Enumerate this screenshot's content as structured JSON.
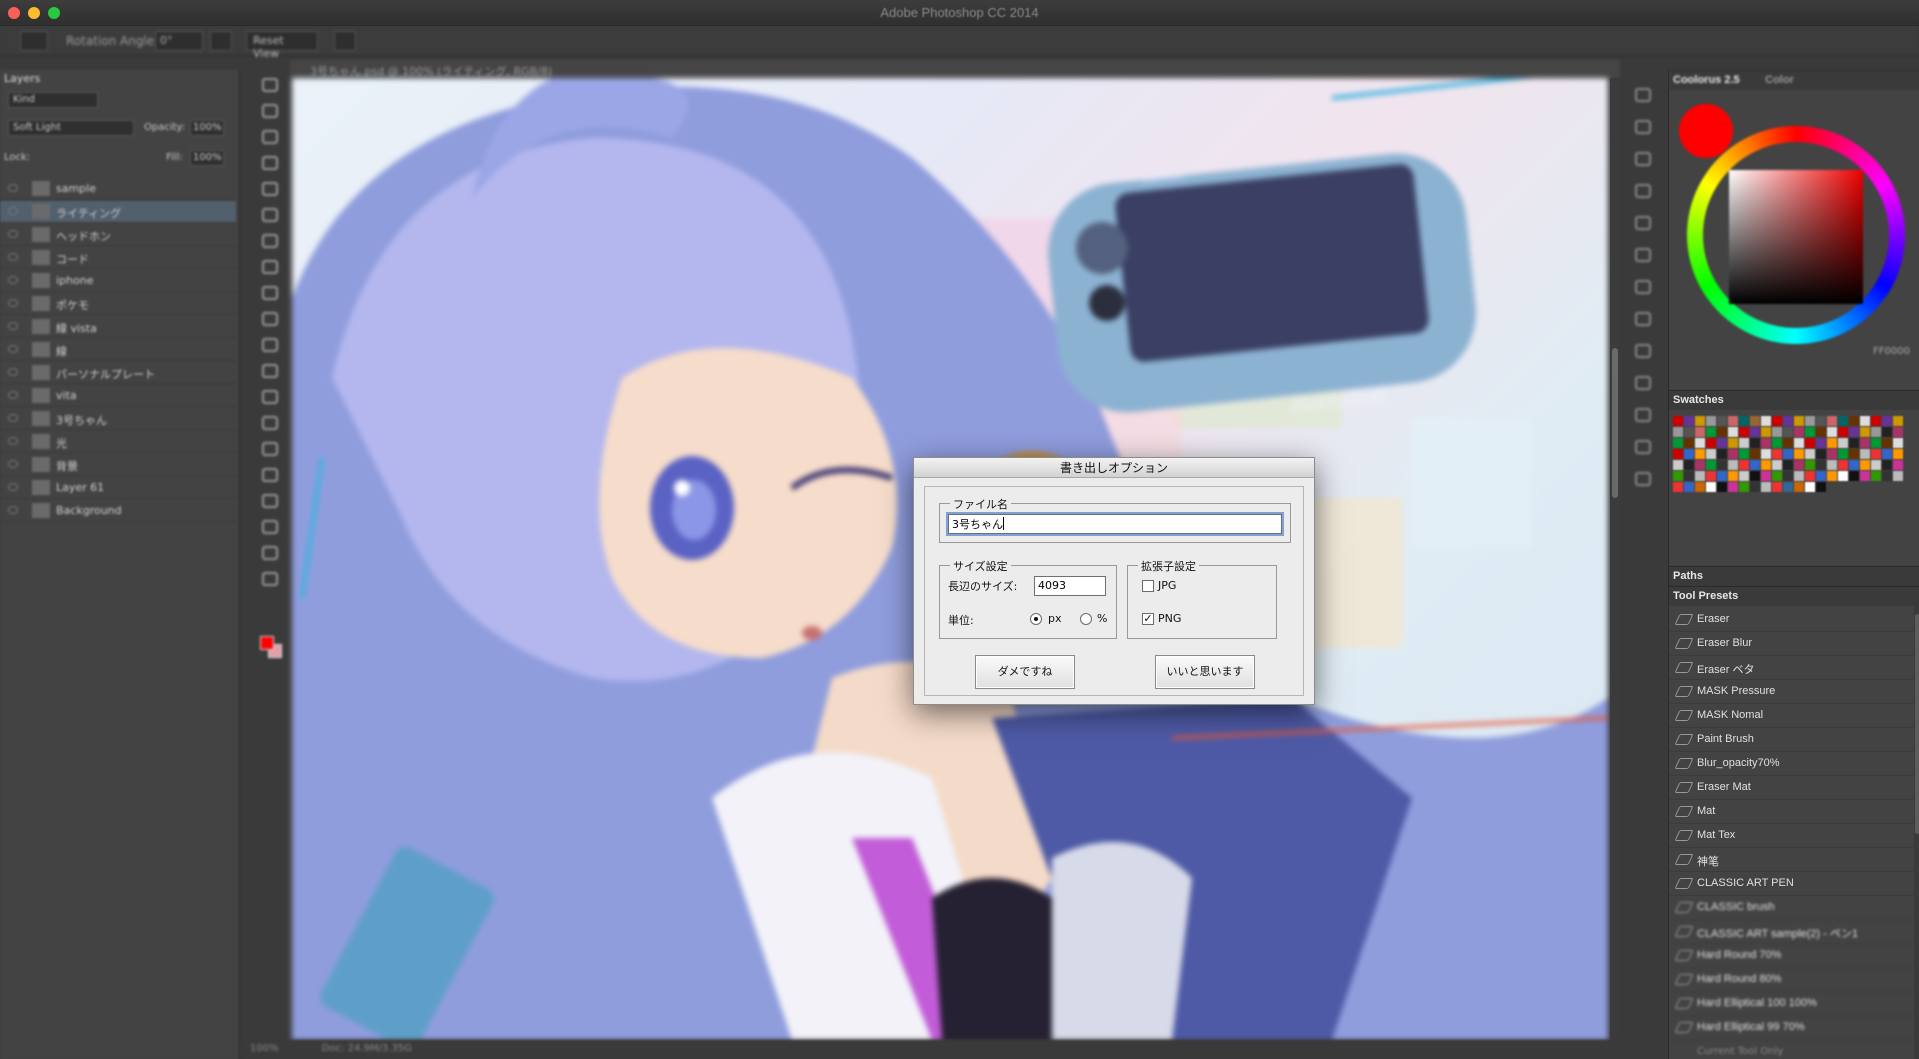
{
  "app": {
    "title": "Adobe Photoshop CC 2014"
  },
  "options_bar": {
    "rotation_label": "Rotation Angle:",
    "rotation_value": "0°",
    "reset_label": "Reset View"
  },
  "layers_panel": {
    "tab": "Layers",
    "kind_filter": "Kind",
    "blend_mode": "Soft Light",
    "opacity_label": "Opacity:",
    "opacity_value": "100%",
    "lock_label": "Lock:",
    "fill_label": "Fill:",
    "fill_value": "100%",
    "layers": [
      {
        "name": "sample"
      },
      {
        "name": "ライティング",
        "selected": true
      },
      {
        "name": "ヘッドホン"
      },
      {
        "name": "コード"
      },
      {
        "name": "iphone"
      },
      {
        "name": "ポケモ"
      },
      {
        "name": "線 vista"
      },
      {
        "name": "線"
      },
      {
        "name": "パーソナルプレート"
      },
      {
        "name": "vita"
      },
      {
        "name": "3号ちゃん"
      },
      {
        "name": "光"
      },
      {
        "name": "背景"
      },
      {
        "name": "Layer 61"
      },
      {
        "name": "Background"
      }
    ]
  },
  "document": {
    "tab": "3号ちゃん.psd @ 100% (ライティング, RGB/8)",
    "zoom": "100%",
    "doc_info": "Doc: 24.9M/3.35G"
  },
  "color_panel": {
    "tab": "Coolorus 2.5",
    "tab2": "Color",
    "hex": "FF0000",
    "fg_color": "#ff0000"
  },
  "swatches_panel": {
    "title": "Swatches"
  },
  "paths_panel": {
    "title": "Paths"
  },
  "tool_presets": {
    "title": "Tool Presets",
    "items": [
      "Eraser",
      "Eraser Blur",
      "Eraser ベタ",
      "MASK Pressure",
      "MASK Nomal",
      "Paint Brush",
      "Blur_opacity70%",
      "Eraser Mat",
      "Mat",
      "Mat Tex",
      "神笔",
      "CLASSIC ART PEN",
      "CLASSIC brush",
      "CLASSIC ART sample(2) - ペン1",
      "Hard Round 70%",
      "Hard Round 80%",
      "Hard Elliptical 100 100%",
      "Hard Elliptical 99 70%"
    ],
    "footer": "Current Tool Only"
  },
  "dialog": {
    "title": "書き出しオプション",
    "filename_group": "ファイル名",
    "filename_value": "3号ちゃん",
    "size_group": "サイズ設定",
    "long_side_label": "長辺のサイズ:",
    "long_side_value": "4093",
    "unit_label": "単位:",
    "unit_px": "px",
    "unit_percent": "%",
    "unit_selected": "px",
    "ext_group": "拡張子設定",
    "jpg_label": "JPG",
    "jpg_checked": false,
    "png_label": "PNG",
    "png_checked": true,
    "cancel_label": "ダメですね",
    "ok_label": "いいと思います"
  }
}
